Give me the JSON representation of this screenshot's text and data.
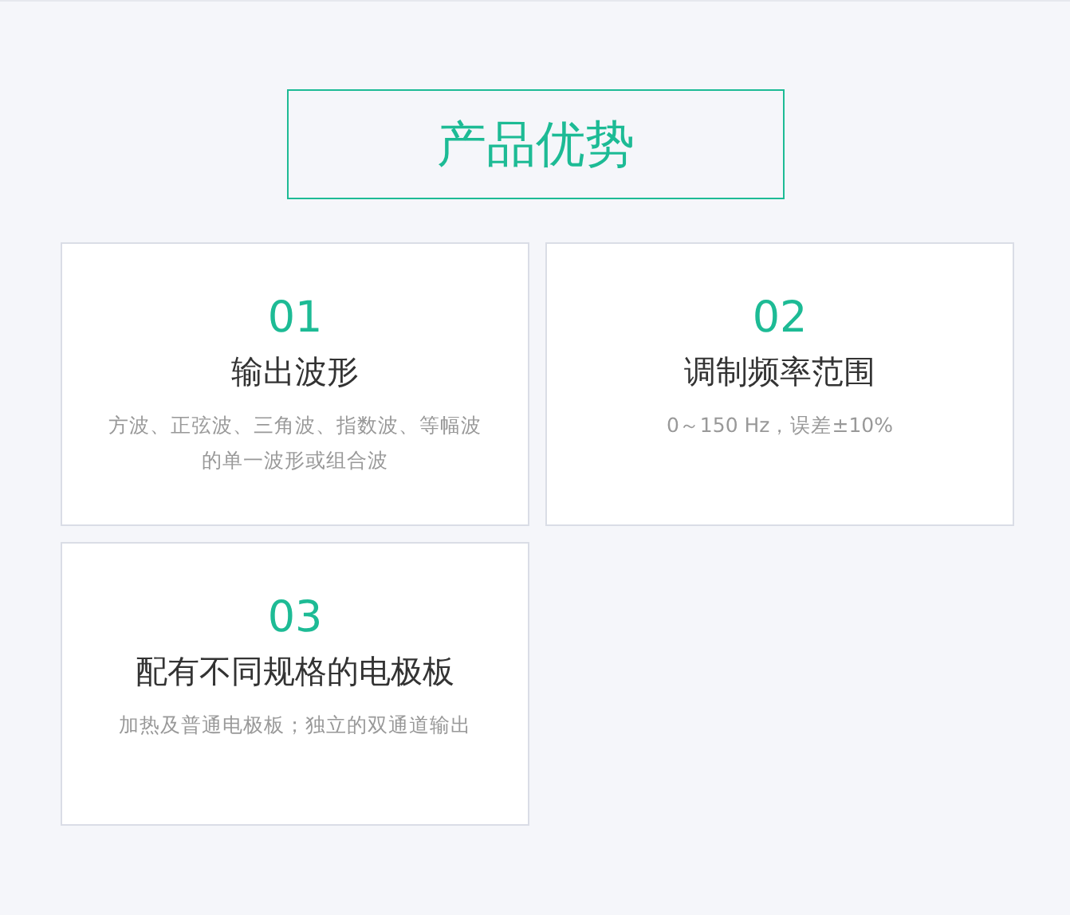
{
  "section": {
    "title": "产品优势"
  },
  "features": [
    {
      "number": "01",
      "title": "输出波形",
      "description": "方波、正弦波、三角波、指数波、等幅波的单一波形或组合波"
    },
    {
      "number": "02",
      "title": "调制频率范围",
      "description": "0～150 Hz，误差±10%"
    },
    {
      "number": "03",
      "title": "配有不同规格的电极板",
      "description": "加热及普通电极板；独立的双通道输出"
    }
  ]
}
